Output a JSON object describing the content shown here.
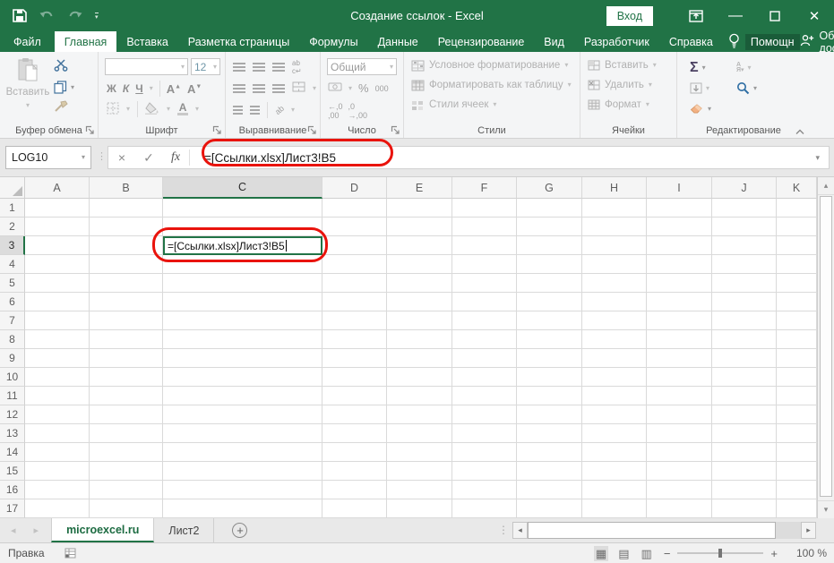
{
  "titlebar": {
    "title": "Создание ссылок  -  Excel",
    "signin": "Вход"
  },
  "ribbon_tabs": [
    {
      "label": "Файл",
      "file": true
    },
    {
      "label": "Главная",
      "active": true
    },
    {
      "label": "Вставка"
    },
    {
      "label": "Разметка страницы"
    },
    {
      "label": "Формулы"
    },
    {
      "label": "Данные"
    },
    {
      "label": "Рецензирование"
    },
    {
      "label": "Вид"
    },
    {
      "label": "Разработчик"
    },
    {
      "label": "Справка"
    }
  ],
  "help": {
    "assistant": "Помощн",
    "share": "Общий доступ"
  },
  "ribbon": {
    "clipboard": {
      "label": "Буфер обмена",
      "paste": "Вставить"
    },
    "font": {
      "label": "Шрифт",
      "size": "12",
      "bold": "Ж",
      "italic": "К",
      "underline": "Ч",
      "grow": "А",
      "shrink": "А",
      "color_letter": "А"
    },
    "alignment": {
      "label": "Выравнивание"
    },
    "number": {
      "label": "Число",
      "format": "Общий",
      "percent": "%",
      "thousands": "000",
      "dec_inc": ",0",
      "dec_dec": ",00"
    },
    "styles": {
      "label": "Стили",
      "items": [
        "Условное форматирование",
        "Форматировать как таблицу",
        "Стили ячеек"
      ]
    },
    "cells": {
      "label": "Ячейки",
      "items": [
        "Вставить",
        "Удалить",
        "Формат"
      ]
    },
    "editing": {
      "label": "Редактирование",
      "sum": "Σ"
    }
  },
  "formula_bar": {
    "name_box": "LOG10",
    "cancel": "×",
    "enter": "✓",
    "fx": "fx",
    "formula": "=[Ссылки.xlsx]Лист3!B5"
  },
  "grid": {
    "columns": [
      "A",
      "B",
      "C",
      "D",
      "E",
      "F",
      "G",
      "H",
      "I",
      "J",
      "K"
    ],
    "rows": [
      "1",
      "2",
      "3",
      "4",
      "5",
      "6",
      "7",
      "8",
      "9",
      "10",
      "11",
      "12",
      "13",
      "14",
      "15",
      "16",
      "17"
    ],
    "selected_column": "C",
    "selected_row": "3",
    "active_cell": "C3",
    "cell_value": "=[Ссылки.xlsx]Лист3!B5"
  },
  "sheet_tabs": {
    "items": [
      {
        "label": "microexcel.ru",
        "active": true
      },
      {
        "label": "Лист2",
        "active": false
      }
    ]
  },
  "status_bar": {
    "mode": "Правка",
    "zoom": "100 %",
    "view_normal": "▦",
    "view_layout": "▤",
    "view_break": "▥"
  }
}
